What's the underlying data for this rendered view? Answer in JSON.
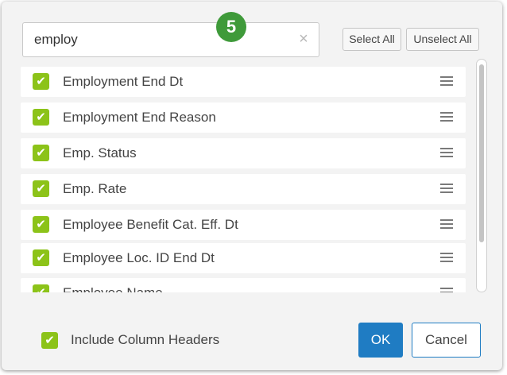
{
  "search": {
    "value": "employ",
    "clear_icon": "×"
  },
  "step_badge": "5",
  "buttons": {
    "select_all": "Select All",
    "unselect_all": "Unselect All",
    "ok": "OK",
    "cancel": "Cancel"
  },
  "columns": [
    {
      "label": "Employment End Dt",
      "checked": true
    },
    {
      "label": "Employment End Reason",
      "checked": true
    },
    {
      "label": "Emp. Status",
      "checked": true
    },
    {
      "label": "Emp. Rate",
      "checked": true
    },
    {
      "label": "Employee Benefit Cat. Eff. Dt",
      "checked": true
    },
    {
      "label": "Employee Loc. ID End Dt",
      "checked": true
    },
    {
      "label": "Employee Name",
      "checked": true
    }
  ],
  "footer": {
    "include_headers_label": "Include Column Headers",
    "include_headers_checked": true
  },
  "colors": {
    "accent": "#1f7cc3",
    "check": "#8cc319",
    "badge": "#3f9a3a"
  },
  "icons": {
    "check": "check-icon",
    "drag": "drag-handle-icon",
    "clear": "clear-icon"
  }
}
